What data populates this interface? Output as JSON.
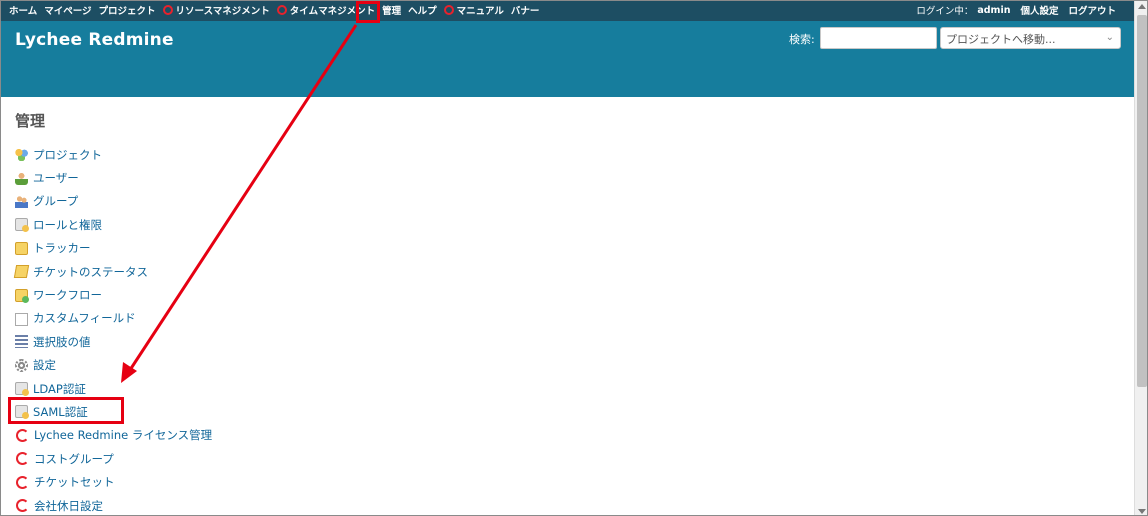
{
  "top_menu": {
    "items": [
      {
        "label": "ホーム",
        "icon": null
      },
      {
        "label": "マイページ",
        "icon": null
      },
      {
        "label": "プロジェクト",
        "icon": null
      },
      {
        "label": "リソースマネジメント",
        "icon": "lychee-icon"
      },
      {
        "label": "タイムマネジメント",
        "icon": "lychee-icon"
      },
      {
        "label": "管理",
        "icon": null
      },
      {
        "label": "ヘルプ",
        "icon": null
      },
      {
        "label": "マニュアル",
        "icon": "lychee-icon"
      },
      {
        "label": "バナー",
        "icon": null
      }
    ],
    "login_label": "ログイン中：",
    "login_user": "admin",
    "my_account": "個人設定",
    "logout": "ログアウト"
  },
  "header": {
    "title": "Lychee Redmine",
    "search_label": "検索:",
    "search_value": "",
    "jump_placeholder": "プロジェクトへ移動..."
  },
  "main": {
    "title": "管理",
    "menu": [
      {
        "label": "プロジェクト",
        "icon": "projects-icon"
      },
      {
        "label": "ユーザー",
        "icon": "user-icon"
      },
      {
        "label": "グループ",
        "icon": "group-icon"
      },
      {
        "label": "ロールと権限",
        "icon": "roles-icon"
      },
      {
        "label": "トラッカー",
        "icon": "tracker-icon"
      },
      {
        "label": "チケットのステータス",
        "icon": "issue-status-icon"
      },
      {
        "label": "ワークフロー",
        "icon": "workflow-icon"
      },
      {
        "label": "カスタムフィールド",
        "icon": "custom-field-icon"
      },
      {
        "label": "選択肢の値",
        "icon": "enumerations-icon"
      },
      {
        "label": "設定",
        "icon": "settings-icon"
      },
      {
        "label": "LDAP認証",
        "icon": "ldap-auth-icon"
      },
      {
        "label": "SAML認証",
        "icon": "saml-auth-icon"
      },
      {
        "label": "Lychee Redmine ライセンス管理",
        "icon": "lychee-icon"
      },
      {
        "label": "コストグループ",
        "icon": "lychee-icon"
      },
      {
        "label": "チケットセット",
        "icon": "lychee-icon"
      },
      {
        "label": "会社休日設定",
        "icon": "lychee-icon"
      }
    ]
  },
  "colors": {
    "top_menu_bg": "#1d4e63",
    "header_bg": "#167d9d",
    "link": "#116699",
    "annotation_red": "#e60012"
  }
}
